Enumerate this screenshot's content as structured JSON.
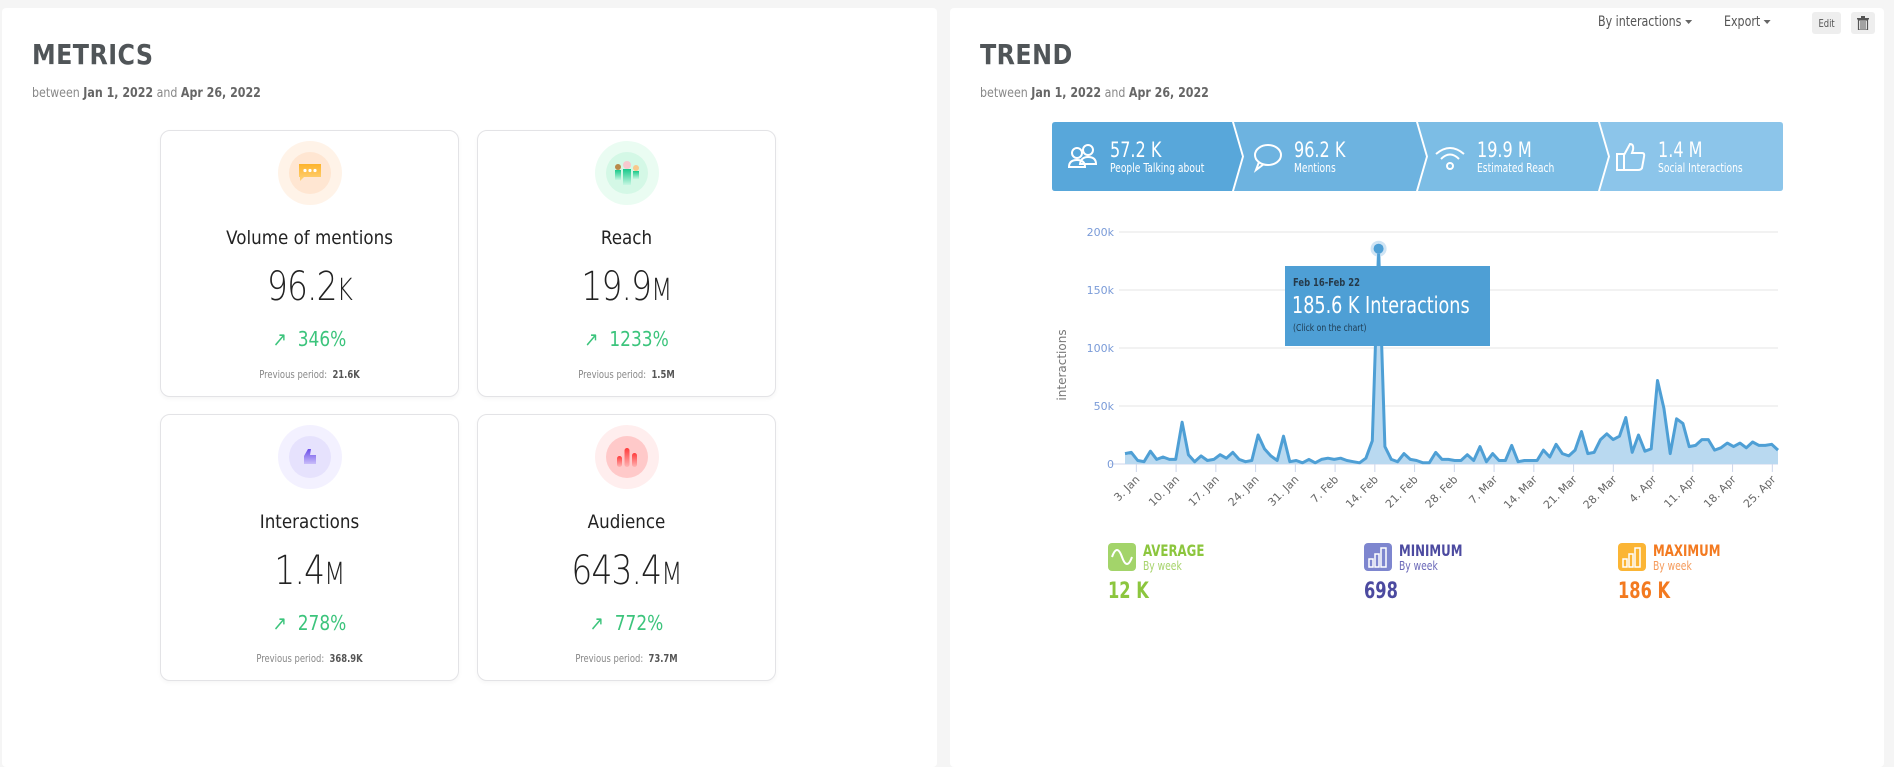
{
  "metrics": {
    "title": "METRICS",
    "between": "between",
    "and": "and",
    "start_date": "Jan 1, 2022",
    "end_date": "Apr 26, 2022",
    "prev_label": "Previous period:",
    "cards": [
      {
        "label": "Volume of mentions",
        "value": "96.2",
        "unit": "K",
        "change": "346%",
        "previous": "21.6K",
        "icon": "chat-bubble-icon",
        "color": "#fdb44b"
      },
      {
        "label": "Reach",
        "value": "19.9",
        "unit": "M",
        "change": "1233%",
        "previous": "1.5M",
        "icon": "people-group-icon",
        "color": "#2ee59d"
      },
      {
        "label": "Interactions",
        "value": "1.4",
        "unit": "M",
        "change": "278%",
        "previous": "368.9K",
        "icon": "thumbs-up-icon",
        "color": "#7b61ff"
      },
      {
        "label": "Audience",
        "value": "643.4",
        "unit": "M",
        "change": "772%",
        "previous": "73.7M",
        "icon": "audience-bars-icon",
        "color": "#ff5a5f"
      }
    ]
  },
  "trend": {
    "title": "TREND",
    "between": "between",
    "and": "and",
    "start_date": "Jan 1, 2022",
    "end_date": "Apr 26, 2022",
    "toolbar": {
      "by_label": "By interactions",
      "export_label": "Export",
      "edit_label": "Edit",
      "delete_icon": "trash-icon"
    },
    "kpis": [
      {
        "value": "57.2 K",
        "label": "People Talking about",
        "icon": "people-icon",
        "color": "#58a7da"
      },
      {
        "value": "96.2 K",
        "label": "Mentions",
        "icon": "speech-bubble-icon",
        "color": "#6db3e0"
      },
      {
        "value": "19.9 M",
        "label": "Estimated Reach",
        "icon": "wifi-signal-icon",
        "color": "#7cbde5"
      },
      {
        "value": "1.4 M",
        "label": "Social Interactions",
        "icon": "thumbs-up-icon",
        "color": "#8cc5ea"
      }
    ],
    "tooltip": {
      "date": "Feb 16-Feb 22",
      "value": "185.6 K Interactions",
      "hint": "(Click on the chart)"
    },
    "stats": [
      {
        "name": "AVERAGE",
        "sub": "By week",
        "value": "12 K",
        "color": "#8cc63e",
        "sub_color": "#a6d36a",
        "icon": "sine-wave-icon"
      },
      {
        "name": "MINIMUM",
        "sub": "By week",
        "value": "698",
        "color": "#4c4aa0",
        "sub_color": "#6a68b8",
        "icon": "bar-chart-icon"
      },
      {
        "name": "MAXIMUM",
        "sub": "By week",
        "value": "186 K",
        "color": "#f37a20",
        "sub_color": "#f59a5a",
        "icon": "bar-chart-icon"
      }
    ]
  },
  "chart_data": {
    "type": "area",
    "title": "",
    "xlabel": "",
    "ylabel": "interactions",
    "ylim": [
      0,
      200000
    ],
    "yticks": [
      "0",
      "50k",
      "100k",
      "150k",
      "200k"
    ],
    "ytick_values": [
      0,
      50000,
      100000,
      150000,
      200000
    ],
    "xticks": [
      "3. Jan",
      "10. Jan",
      "17. Jan",
      "24. Jan",
      "31. Jan",
      "7. Feb",
      "14. Feb",
      "21. Feb",
      "28. Feb",
      "7. Mar",
      "14. Mar",
      "21. Mar",
      "28. Mar",
      "4. Apr",
      "11. Apr",
      "18. Apr",
      "25. Apr"
    ],
    "x_start": "2022-01-01",
    "x_end": "2022-04-26",
    "grid": true,
    "series": [
      {
        "name": "interactions",
        "color": "#4e9fd5",
        "values": [
          9000,
          10000,
          3000,
          2000,
          11000,
          4000,
          6000,
          4000,
          4000,
          36000,
          8000,
          2000,
          7000,
          3000,
          4000,
          8000,
          5000,
          10000,
          4000,
          2000,
          3000,
          25000,
          13000,
          7000,
          3000,
          24000,
          2000,
          3000,
          1000,
          4000,
          1000,
          4000,
          5000,
          4000,
          5000,
          3000,
          2000,
          1000,
          5000,
          20000,
          185600,
          15000,
          4000,
          2000,
          9000,
          4000,
          3000,
          1000,
          1000,
          10000,
          4000,
          4000,
          3000,
          3000,
          8000,
          3000,
          15000,
          2000,
          9000,
          3000,
          3000,
          16000,
          2000,
          3000,
          3000,
          3000,
          12000,
          6000,
          17000,
          9000,
          7000,
          12000,
          28000,
          9000,
          10000,
          21000,
          26000,
          21000,
          24000,
          40000,
          10000,
          25000,
          11000,
          13000,
          72000,
          48000,
          9000,
          39000,
          35000,
          15000,
          16000,
          21000,
          21000,
          12000,
          14000,
          18000,
          15000,
          18000,
          14000,
          19000,
          16000,
          16000,
          17000,
          12000
        ]
      }
    ],
    "highlight": {
      "label": "Feb 16-Feb 22",
      "value": 185600
    }
  }
}
